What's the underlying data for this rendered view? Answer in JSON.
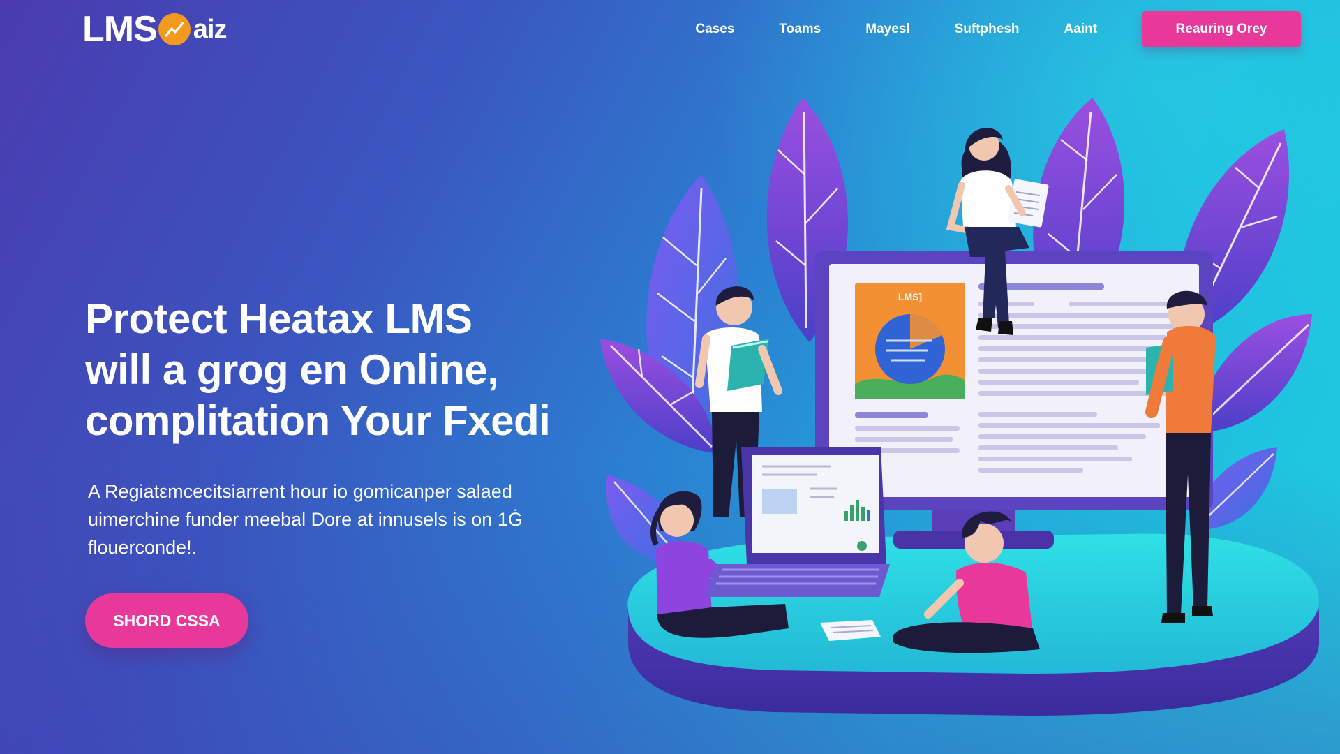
{
  "header": {
    "logo": {
      "text_left": "LMS",
      "text_right": "aiz",
      "mark_icon": "chart-line-icon",
      "mark_color": "#f29a1f"
    },
    "nav": [
      {
        "label": "Cases"
      },
      {
        "label": "Toams"
      },
      {
        "label": "Mayesl"
      },
      {
        "label": "Suftphesh"
      },
      {
        "label": "Aaint"
      }
    ],
    "cta_label": "Reauring Orey",
    "cta_color": "#e8399a"
  },
  "hero": {
    "title_lines": [
      "Protect Heatax LMS",
      "will a grog en Online,",
      "complitation Your Fxedi"
    ],
    "subtitle_lines": [
      "A Regiatεmcecitsiarrent hour io gomicanper salaed",
      "uimerchine funder meebal Dore at innusels is on 1Ġ",
      "flouerconde!."
    ],
    "cta_label": "SHORD CSSA",
    "cta_color": "#e8399a"
  },
  "illustration": {
    "screen_card_label": "LMS]",
    "icons": [
      "leaf-icon",
      "monitor-icon",
      "laptop-icon",
      "person-icon",
      "book-icon",
      "document-icon",
      "pie-chart-icon",
      "bar-chart-icon"
    ]
  },
  "colors": {
    "background_start": "#4a3bb0",
    "background_end": "#1fd2e0",
    "accent": "#e8399a",
    "platform": "#27d6df"
  }
}
